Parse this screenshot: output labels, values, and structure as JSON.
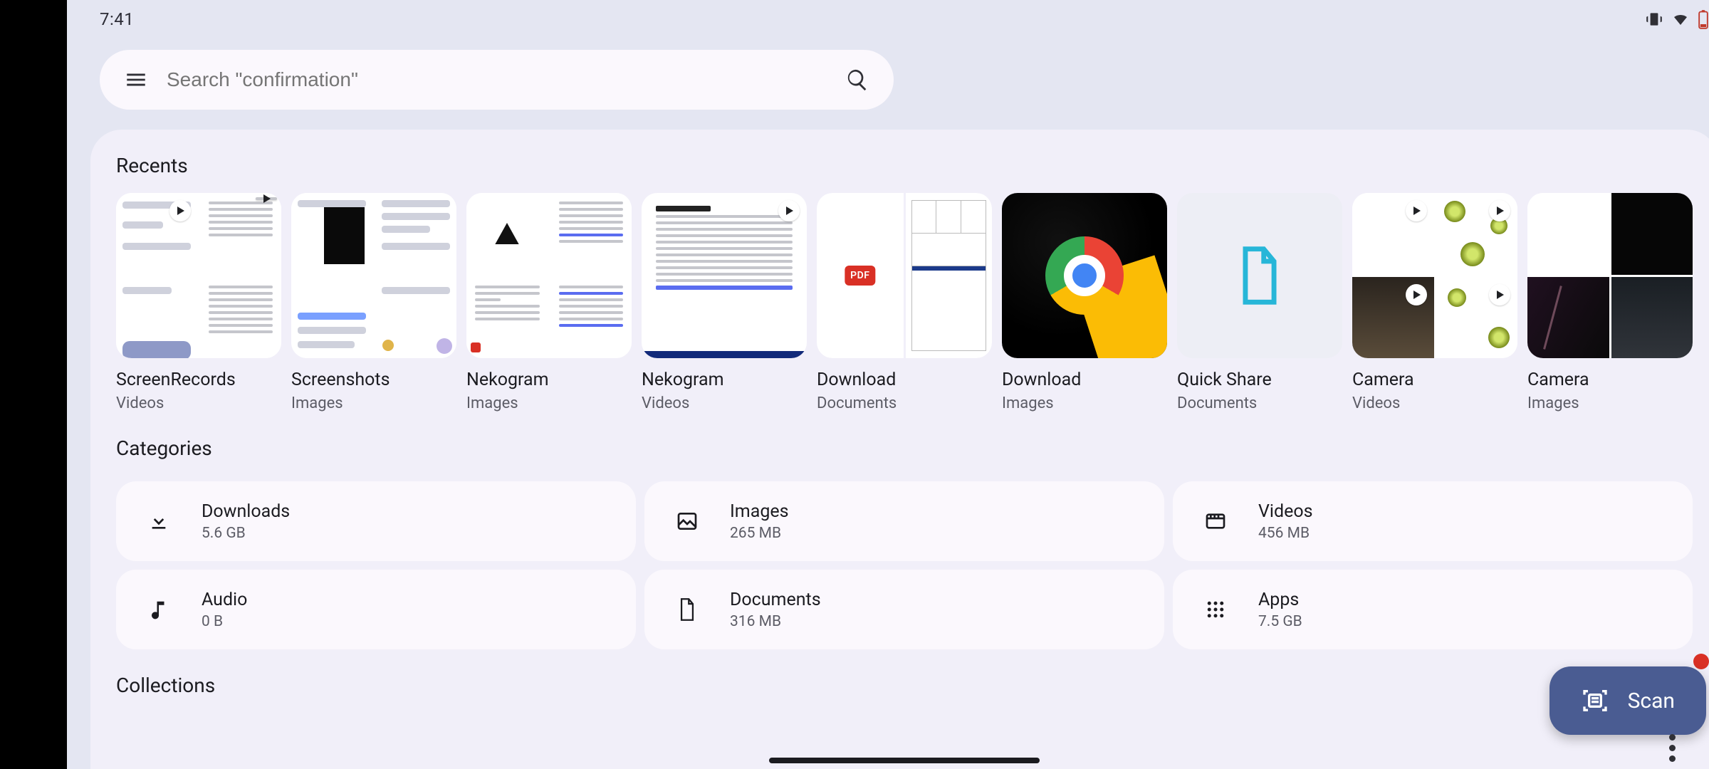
{
  "status": {
    "time": "7:41"
  },
  "search": {
    "placeholder": "Search \"confirmation\""
  },
  "sections": {
    "recents_title": "Recents",
    "categories_title": "Categories",
    "collections_title": "Collections"
  },
  "recents": [
    {
      "title": "ScreenRecords",
      "subtitle": "Videos",
      "kind": "videos-grid"
    },
    {
      "title": "Screenshots",
      "subtitle": "Images",
      "kind": "images-grid"
    },
    {
      "title": "Nekogram",
      "subtitle": "Images",
      "kind": "doc-grid"
    },
    {
      "title": "Nekogram",
      "subtitle": "Videos",
      "kind": "doc-single-video"
    },
    {
      "title": "Download",
      "subtitle": "Documents",
      "kind": "pdf-pair"
    },
    {
      "title": "Download",
      "subtitle": "Images",
      "kind": "chrome"
    },
    {
      "title": "Quick Share",
      "subtitle": "Documents",
      "kind": "quickshare"
    },
    {
      "title": "Camera",
      "subtitle": "Videos",
      "kind": "camera-videos"
    },
    {
      "title": "Camera",
      "subtitle": "Images",
      "kind": "camera-images"
    }
  ],
  "categories": [
    {
      "name": "Downloads",
      "size": "5.6 GB"
    },
    {
      "name": "Images",
      "size": "265 MB"
    },
    {
      "name": "Videos",
      "size": "456 MB"
    },
    {
      "name": "Audio",
      "size": "0 B"
    },
    {
      "name": "Documents",
      "size": "316 MB"
    },
    {
      "name": "Apps",
      "size": "7.5 GB"
    }
  ],
  "fab": {
    "label": "Scan"
  }
}
